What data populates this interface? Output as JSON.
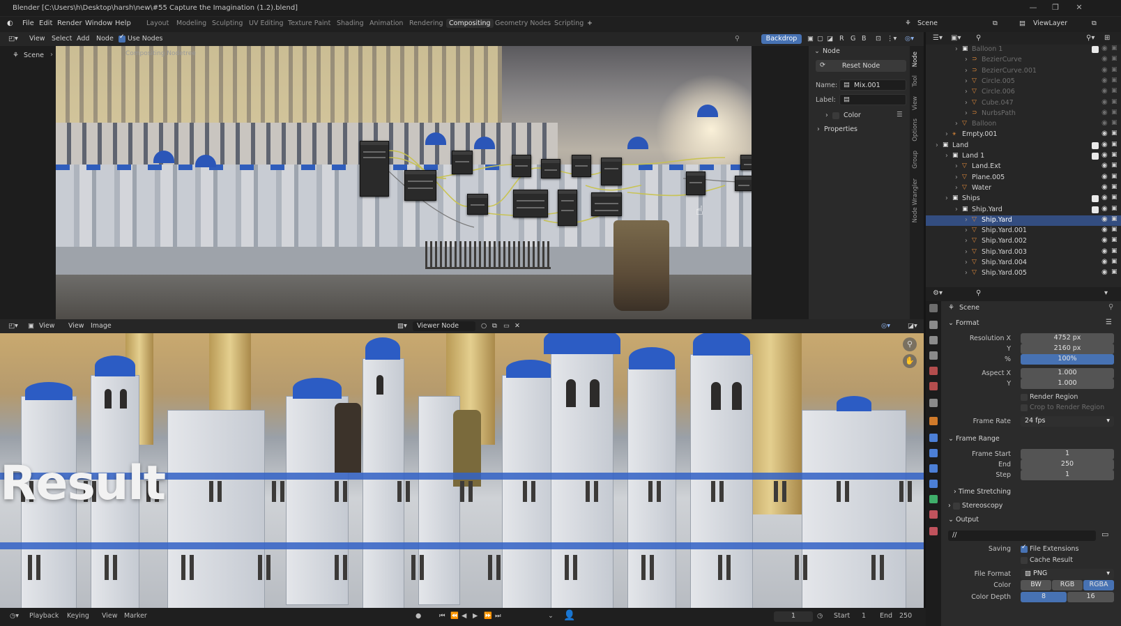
{
  "window": {
    "title": "Blender [C:\\Users\\h\\Desktop\\harsh\\new\\#55 Capture the Imagination (1.2).blend]",
    "controls": [
      "—",
      "❐",
      "✕"
    ]
  },
  "menubar": {
    "items": [
      "File",
      "Edit",
      "Render",
      "Window",
      "Help"
    ],
    "workspaces": [
      "Layout",
      "Modeling",
      "Sculpting",
      "UV Editing",
      "Texture Paint",
      "Shading",
      "Animation",
      "Rendering",
      "Compositing",
      "Geometry Nodes",
      "Scripting"
    ],
    "active_workspace": "Compositing",
    "add_label": "+",
    "scene_label": "Scene",
    "viewlayer_label": "ViewLayer"
  },
  "node_editor": {
    "menus": [
      "View",
      "Select",
      "Add",
      "Node"
    ],
    "use_nodes_label": "Use Nodes",
    "backdrop_label": "Backdrop",
    "channel_labels": [
      "R",
      "G",
      "B"
    ],
    "breadcrumb_scene": "Scene",
    "breadcrumb_tree": "Compositing Nodetree"
  },
  "n_panel": {
    "section": "Node",
    "reset_label": "Reset Node",
    "name_label": "Name:",
    "name_value": "Mix.001",
    "label_label": "Label:",
    "label_value": "",
    "color_label": "Color",
    "properties_label": "Properties",
    "tabs": [
      "Node",
      "Tool",
      "View",
      "Options",
      "Group",
      "Node Wrangler"
    ]
  },
  "outliner": {
    "rows": [
      {
        "label": "Balloon 1",
        "indent": 3,
        "kind": "collection",
        "dim": true,
        "check": true
      },
      {
        "label": "BezierCurve",
        "indent": 4,
        "kind": "curve",
        "dim": true
      },
      {
        "label": "BezierCurve.001",
        "indent": 4,
        "kind": "curve",
        "dim": true
      },
      {
        "label": "Circle.005",
        "indent": 4,
        "kind": "mesh",
        "dim": true
      },
      {
        "label": "Circle.006",
        "indent": 4,
        "kind": "mesh",
        "dim": true
      },
      {
        "label": "Cube.047",
        "indent": 4,
        "kind": "mesh",
        "dim": true
      },
      {
        "label": "NurbsPath",
        "indent": 4,
        "kind": "curve",
        "dim": true
      },
      {
        "label": "Balloon",
        "indent": 3,
        "kind": "mesh",
        "dim": true
      },
      {
        "label": "Empty.001",
        "indent": 2,
        "kind": "empty",
        "dim": false
      },
      {
        "label": "Land",
        "indent": 1,
        "kind": "collection",
        "dim": false,
        "check": true
      },
      {
        "label": "Land 1",
        "indent": 2,
        "kind": "collection",
        "dim": false,
        "check": true
      },
      {
        "label": "Land.Ext",
        "indent": 3,
        "kind": "mesh",
        "dim": false
      },
      {
        "label": "Plane.005",
        "indent": 3,
        "kind": "mesh",
        "dim": false
      },
      {
        "label": "Water",
        "indent": 3,
        "kind": "mesh",
        "dim": false
      },
      {
        "label": "Ships",
        "indent": 2,
        "kind": "collection",
        "dim": false,
        "check": true
      },
      {
        "label": "Ship.Yard",
        "indent": 3,
        "kind": "collection",
        "dim": false,
        "check": true
      },
      {
        "label": "Ship.Yard",
        "indent": 4,
        "kind": "mesh",
        "dim": false,
        "selected": true
      },
      {
        "label": "Ship.Yard.001",
        "indent": 4,
        "kind": "mesh",
        "dim": false
      },
      {
        "label": "Ship.Yard.002",
        "indent": 4,
        "kind": "mesh",
        "dim": false
      },
      {
        "label": "Ship.Yard.003",
        "indent": 4,
        "kind": "mesh",
        "dim": false
      },
      {
        "label": "Ship.Yard.004",
        "indent": 4,
        "kind": "mesh",
        "dim": false
      },
      {
        "label": "Ship.Yard.005",
        "indent": 4,
        "kind": "mesh",
        "dim": false
      }
    ]
  },
  "properties": {
    "context": "Scene",
    "format_section": "Format",
    "resolution_x_label": "Resolution X",
    "resolution_x": "4752 px",
    "y_label": "Y",
    "resolution_y": "2160 px",
    "percent_label": "%",
    "percent": "100%",
    "aspect_x_label": "Aspect X",
    "aspect_x": "1.000",
    "aspect_y": "1.000",
    "render_region_label": "Render Region",
    "crop_label": "Crop to Render Region",
    "frame_rate_label": "Frame Rate",
    "frame_rate": "24 fps",
    "frame_range_section": "Frame Range",
    "frame_start_label": "Frame Start",
    "frame_start": "1",
    "end_label": "End",
    "frame_end": "250",
    "step_label": "Step",
    "step": "1",
    "time_stretching": "Time Stretching",
    "stereoscopy": "Stereoscopy",
    "output_section": "Output",
    "output_path": "//",
    "saving_label": "Saving",
    "file_extensions_label": "File Extensions",
    "cache_result_label": "Cache Result",
    "file_format_label": "File Format",
    "file_format": "PNG",
    "color_label": "Color",
    "color_modes": [
      "BW",
      "RGB",
      "RGBA"
    ],
    "active_color_mode": "RGBA",
    "color_depth_label": "Color Depth",
    "color_depths": [
      "8",
      "16"
    ]
  },
  "image_editor": {
    "menus": [
      "View",
      "View",
      "Image"
    ],
    "image_name": "Viewer Node",
    "overlay_text": "Result"
  },
  "timeline": {
    "menus": [
      "Playback",
      "Keying",
      "View",
      "Marker"
    ],
    "current_frame": "1",
    "start_label": "Start",
    "start": "1",
    "end_label": "End",
    "end": "250"
  },
  "colors": {
    "accent": "#4772b3",
    "selection": "#334d80",
    "active_workspace_bg": "#2f2f2f"
  }
}
